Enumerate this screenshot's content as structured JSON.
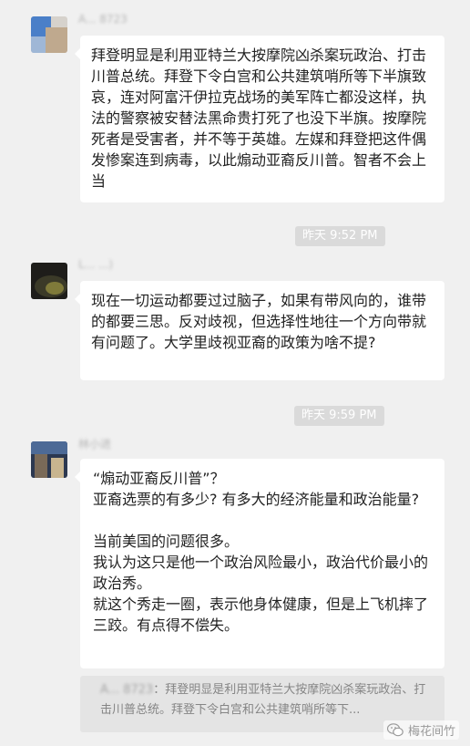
{
  "messages": [
    {
      "sender": "A... 8723",
      "text": "拜登明显是利用亚特兰大按摩院凶杀案玩政治、打击川普总统。拜登下令白宫和公共建筑哨所等下半旗致哀，连对阿富汗伊拉克战场的美军阵亡都没这样，执法的警察被安替法黑命贵打死了也没下半旗。按摩院死者是受害者，并不等于英雄。左媒和拜登把这件偶发惨案连到病毒，以此煽动亚裔反川普。智者不会上当"
    },
    {
      "timestamp": "昨天 9:52 PM",
      "sender": "L... ...)",
      "text": "现在一切运动都要过过脑子，如果有带风向的，谁带的都要三思。反对歧视，但选择性地往一个方向带就有问题了。大学里歧视亚裔的政策为啥不提?"
    },
    {
      "timestamp": "昨天 9:59 PM",
      "sender": "林小进",
      "lines": [
        "“煽动亚裔反川普”？",
        "亚裔选票的有多少? 有多大的经济能量和政治能量?",
        "",
        "当前美国的问题很多。",
        "我认为这只是他一个政治风险最小，政治代价最小的政治秀。",
        "就这个秀走一圈，表示他身体健康，但是上飞机摔了三跤。有点得不偿失。"
      ]
    }
  ],
  "quote": {
    "sender": "A... 8723",
    "text": "拜登明显是利用亚特兰大按摩院凶杀案玩政治、打击川普总统。拜登下令白宫和公共建筑哨所等下..."
  },
  "watermark": {
    "text": "梅花间竹",
    "icon": "wechat-icon"
  }
}
